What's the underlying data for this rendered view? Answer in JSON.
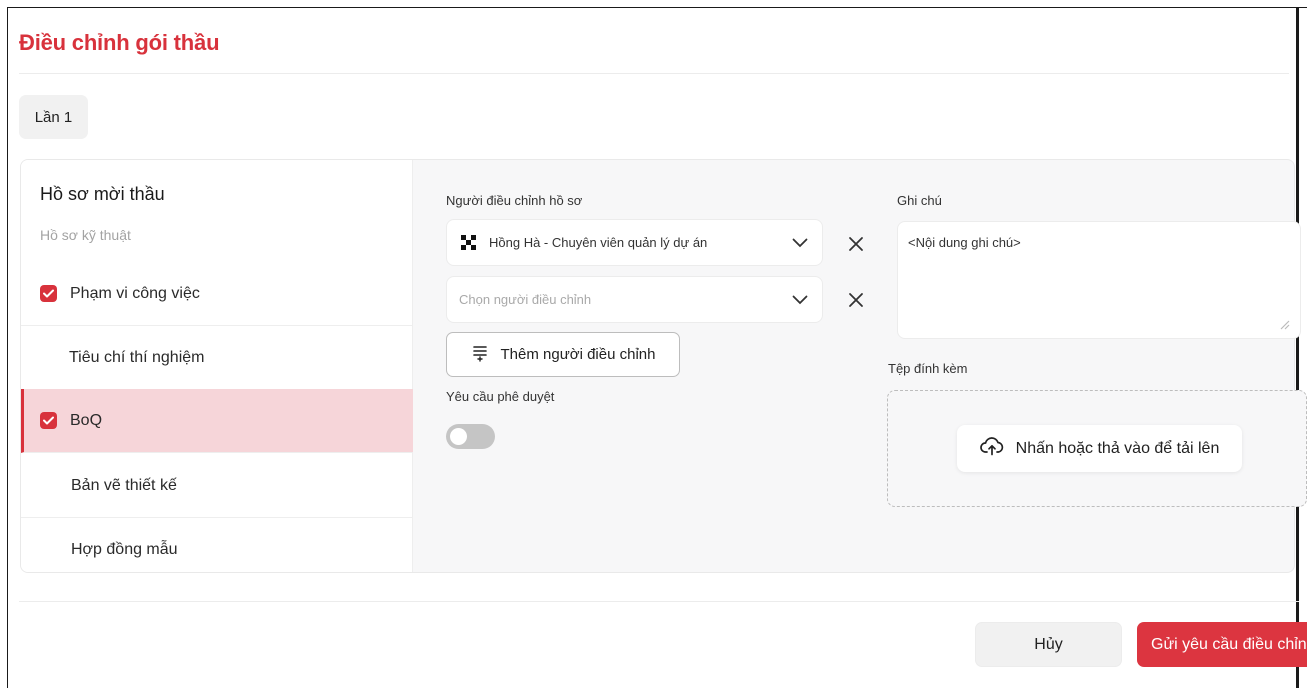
{
  "dialog": {
    "title": "Điều chỉnh gói thầu",
    "round_tab": "Lần 1"
  },
  "sidebar": {
    "heading": "Hồ sơ mời thầu",
    "subheading": "Hồ sơ kỹ thuật",
    "items": [
      {
        "label": "Phạm vi công việc",
        "checked": true,
        "active": false
      },
      {
        "label": "Tiêu chí thí nghiệm",
        "checked": false,
        "active": false
      },
      {
        "label": "BoQ",
        "checked": true,
        "active": true
      },
      {
        "label": "Bản vẽ thiết kế",
        "checked": false,
        "active": false
      },
      {
        "label": "Hợp đồng mẫu",
        "checked": false,
        "active": false
      }
    ]
  },
  "form": {
    "adjusters_label": "Người điều chỉnh hồ sơ",
    "adjuster_1_value": "Hồng Hà - Chuyên viên quản lý dự án",
    "adjuster_2_placeholder": "Chọn người điều chỉnh",
    "add_adjuster_label": "Thêm người điều chỉnh",
    "approval_label": "Yêu cầu phê duyệt",
    "approval_enabled": false,
    "note_label": "Ghi chú",
    "note_placeholder": "<Nội dung ghi chú>",
    "attachment_label": "Tệp đính kèm",
    "upload_label": "Nhấn hoặc thả vào để tải lên"
  },
  "footer": {
    "cancel_label": "Hủy",
    "submit_label": "Gửi yêu cầu điều chỉnh"
  },
  "colors": {
    "accent": "#d8323c",
    "active_row_bg": "#f6d5d9",
    "toggle_off": "#c5c5c5"
  },
  "icons": [
    "check-icon",
    "chevron-down-icon",
    "close-icon",
    "add-user-icon",
    "upload-cloud-icon",
    "resize-handle-icon",
    "avatar-icon"
  ]
}
